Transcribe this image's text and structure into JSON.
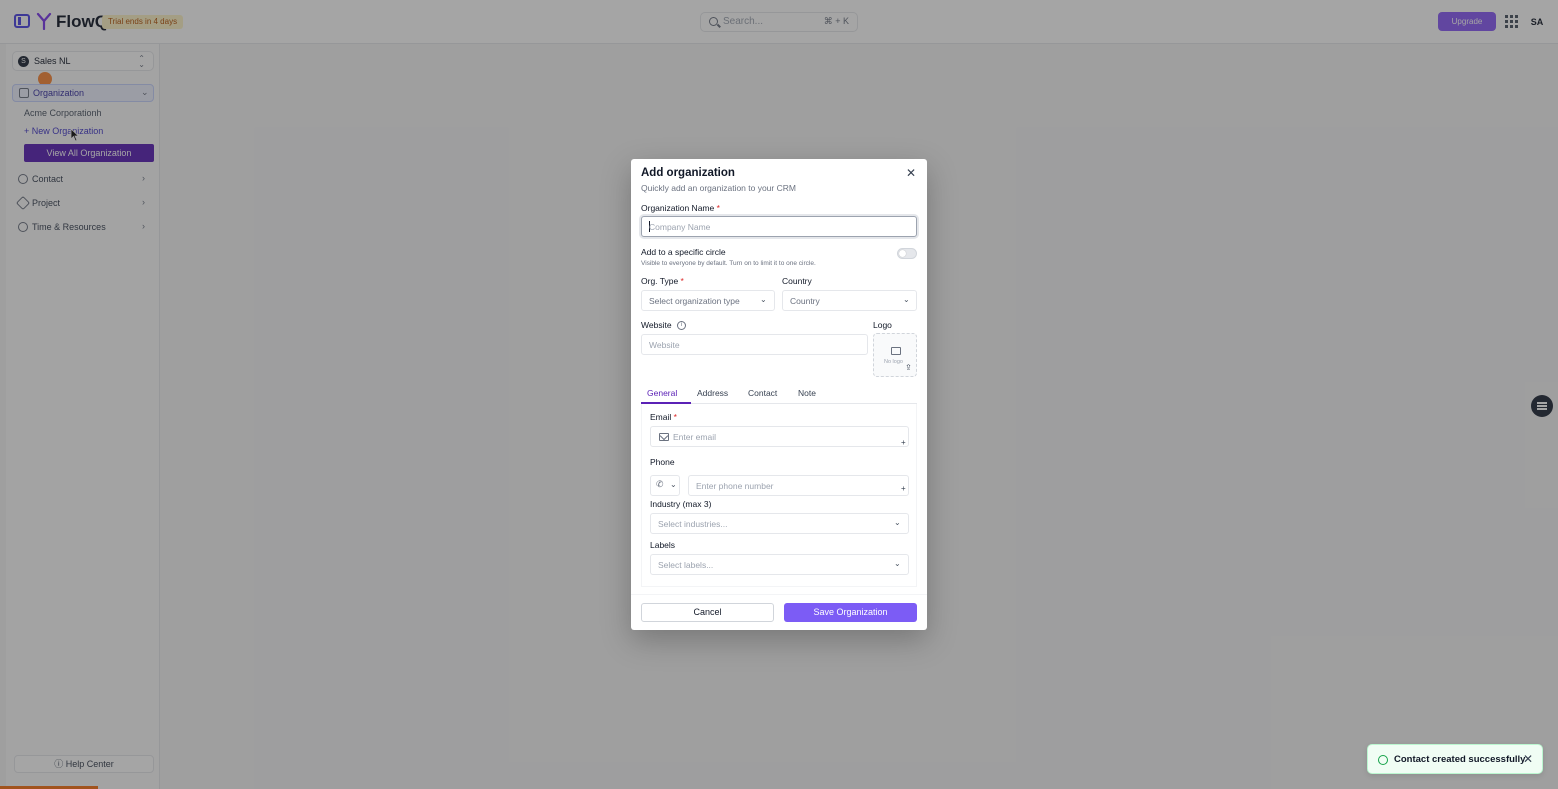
{
  "app": {
    "name": "FlowQi",
    "trial_badge": "Trial ends in 4 days",
    "search_placeholder": "Search...",
    "search_shortcut": "⌘ + K",
    "upgrade_label": "Upgrade",
    "avatar_initials": "SA"
  },
  "sidebar": {
    "workspace": {
      "initial": "S",
      "name": "Sales NL"
    },
    "organization": {
      "label": "Organization",
      "items": [
        "Acme Corporationh"
      ],
      "new_label": "New Organization",
      "view_all_label": "View All Organization"
    },
    "sections": [
      {
        "label": "Contact"
      },
      {
        "label": "Project"
      },
      {
        "label": "Time & Resources"
      }
    ],
    "help_label": "Help Center"
  },
  "modal": {
    "title": "Add organization",
    "subtitle": "Quickly add an organization to your CRM",
    "org_name": {
      "label": "Organization Name",
      "placeholder": "Company Name",
      "required": "*"
    },
    "circle": {
      "label": "Add to a specific circle",
      "help": "Visible to everyone by default. Turn on to limit it to one circle.",
      "enabled": false
    },
    "org_type": {
      "label": "Org. Type",
      "placeholder": "Select organization type",
      "required": "*"
    },
    "country": {
      "label": "Country",
      "placeholder": "Country"
    },
    "website": {
      "label": "Website",
      "placeholder": "Website"
    },
    "logo": {
      "label": "Logo",
      "empty_text": "No logo"
    },
    "tabs": [
      "General",
      "Address",
      "Contact",
      "Note"
    ],
    "active_tab": "General",
    "general": {
      "email": {
        "label": "Email",
        "placeholder": "Enter email",
        "required": "*"
      },
      "phone": {
        "label": "Phone",
        "placeholder": "Enter phone number"
      },
      "industry": {
        "label": "Industry (max 3)",
        "placeholder": "Select industries..."
      },
      "labels": {
        "label": "Labels",
        "placeholder": "Select labels..."
      }
    },
    "cancel_label": "Cancel",
    "save_label": "Save Organization"
  },
  "toast": {
    "message": "Contact created successfully",
    "close": "✕"
  },
  "colors": {
    "brand": "#5b21b6",
    "primary_button": "#7c5cf5",
    "toast_bg": "#f0fdf4",
    "toast_icon": "#16a34a"
  }
}
